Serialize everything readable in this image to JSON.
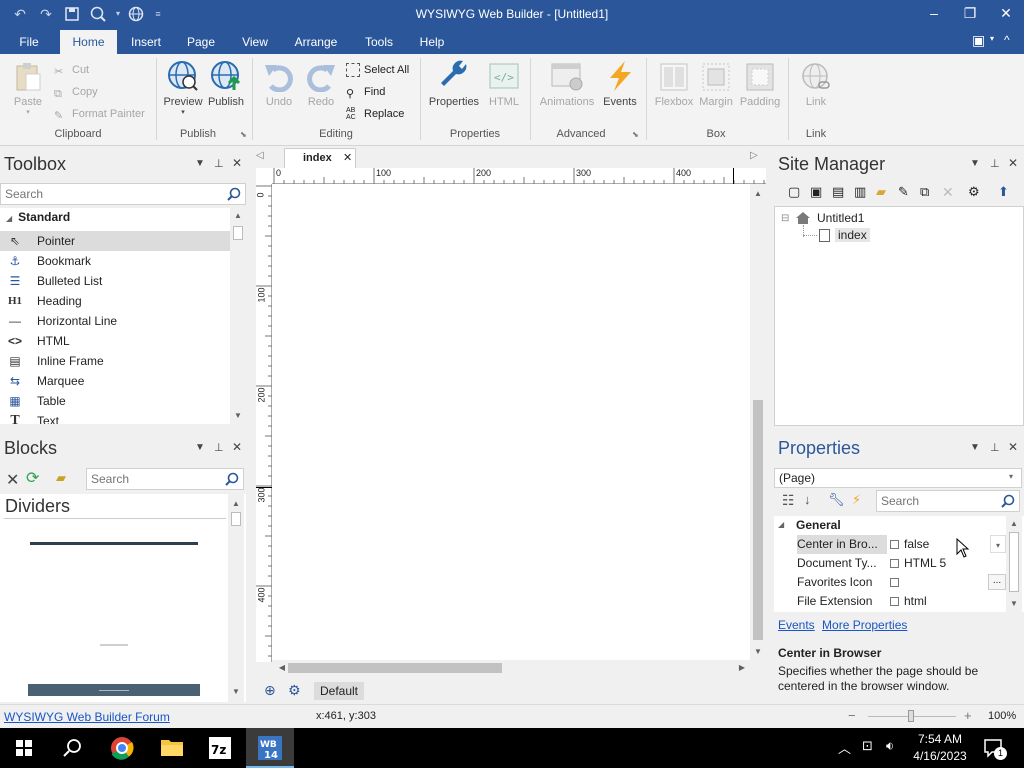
{
  "window": {
    "title": "WYSIWYG Web Builder - [Untitled1]",
    "minimize": "–",
    "restore": "❐",
    "close": "✕"
  },
  "menu": {
    "tabs": [
      "File",
      "Home",
      "Insert",
      "Page",
      "View",
      "Arrange",
      "Tools",
      "Help"
    ],
    "active": "Home"
  },
  "ribbon": {
    "clipboard": {
      "group": "Clipboard",
      "paste": "Paste",
      "cut": "Cut",
      "copy": "Copy",
      "format_painter": "Format Painter"
    },
    "publish": {
      "group": "Publish",
      "preview": "Preview",
      "publish": "Publish"
    },
    "editing": {
      "group": "Editing",
      "undo": "Undo",
      "redo": "Redo",
      "select_all": "Select All",
      "find": "Find",
      "replace": "Replace"
    },
    "properties": {
      "group": "Properties",
      "properties": "Properties",
      "html": "HTML"
    },
    "advanced": {
      "group": "Advanced",
      "animations": "Animations",
      "events": "Events"
    },
    "box": {
      "group": "Box",
      "flexbox": "Flexbox",
      "margin": "Margin",
      "padding": "Padding"
    },
    "link": {
      "group": "Link",
      "link": "Link"
    }
  },
  "toolbox": {
    "title": "Toolbox",
    "search_placeholder": "Search",
    "category": "Standard",
    "items": [
      {
        "label": "Pointer",
        "icon": "pointer-icon",
        "selected": true
      },
      {
        "label": "Bookmark",
        "icon": "anchor-icon"
      },
      {
        "label": "Bulleted List",
        "icon": "bulleted-list-icon"
      },
      {
        "label": "Heading",
        "icon": "heading-icon"
      },
      {
        "label": "Horizontal Line",
        "icon": "horizontal-line-icon"
      },
      {
        "label": "HTML",
        "icon": "code-icon"
      },
      {
        "label": "Inline Frame",
        "icon": "inline-frame-icon"
      },
      {
        "label": "Marquee",
        "icon": "marquee-icon"
      },
      {
        "label": "Table",
        "icon": "table-icon"
      },
      {
        "label": "Text",
        "icon": "text-icon"
      }
    ]
  },
  "blocks": {
    "title": "Blocks",
    "search_placeholder": "Search",
    "category": "Dividers"
  },
  "document": {
    "tab": "index",
    "ruler_h": [
      "0",
      "100",
      "200",
      "300",
      "400"
    ],
    "ruler_v": [
      "0",
      "100",
      "200",
      "300",
      "400"
    ],
    "layout_label": "Default"
  },
  "site_manager": {
    "title": "Site Manager",
    "root": "Untitled1",
    "page": "index"
  },
  "properties": {
    "title": "Properties",
    "object": "(Page)",
    "search_placeholder": "Search",
    "category": "General",
    "rows": [
      {
        "name": "Center in Bro...",
        "value": "false"
      },
      {
        "name": "Document Ty...",
        "value": "HTML 5"
      },
      {
        "name": "Favorites Icon",
        "value": ""
      },
      {
        "name": "File Extension",
        "value": "html"
      }
    ],
    "ellipsis": "...",
    "links": {
      "events": "Events",
      "more": "More Properties"
    },
    "help_title": "Center in Browser",
    "help_text": "Specifies whether the page should be centered in the browser window."
  },
  "status": {
    "forum_link": "WYSIWYG Web Builder Forum",
    "coords": "x:461, y:303",
    "zoom": "100%",
    "zoom_level": 1.0
  },
  "taskbar": {
    "time": "7:54 AM",
    "date": "4/16/2023",
    "notification_count": "1"
  },
  "colors": {
    "accent": "#2b579a",
    "ribbon_bg": "#f3f3f3",
    "panel_title_blue": "#2b579a",
    "selection": "#dcdcdc"
  }
}
